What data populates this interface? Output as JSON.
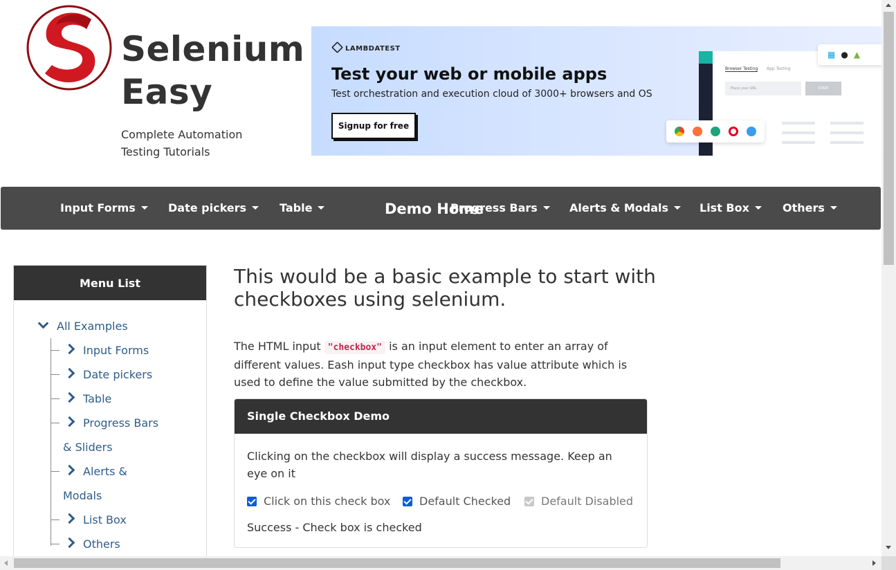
{
  "brand": {
    "title": "Selenium Easy",
    "subtitle": "Complete Automation Testing Tutorials",
    "logo_color": "#c8161d"
  },
  "ad": {
    "logo_text": "LAMBDATEST",
    "headline": "Test your web or mobile apps",
    "text": "Test orchestration and execution cloud of 3000+ browsers and OS",
    "button_label": "Signup for free",
    "mock_tab_1": "Browser Testing",
    "mock_tab_2": "App Testing",
    "mock_url_placeholder": "Place your URL",
    "mock_start": "START"
  },
  "navbar": {
    "home": "Demo Home",
    "items": [
      {
        "label": "Input Forms"
      },
      {
        "label": "Date pickers"
      },
      {
        "label": "Table"
      },
      {
        "label": "Progress Bars"
      },
      {
        "label": "Alerts & Modals"
      },
      {
        "label": "List Box"
      },
      {
        "label": "Others"
      }
    ],
    "bg_color": "#4a4a4a"
  },
  "sidebar": {
    "heading": "Menu List",
    "root": "All Examples",
    "items": [
      {
        "label": "Input Forms"
      },
      {
        "label": "Date pickers"
      },
      {
        "label": "Table"
      },
      {
        "label": "Progress Bars",
        "label_cont": "& Sliders"
      },
      {
        "label": "Alerts &",
        "label_cont": "Modals"
      },
      {
        "label": "List Box"
      },
      {
        "label": "Others"
      }
    ],
    "link_color": "#2e5c8a"
  },
  "main": {
    "title": "This would be a basic example to start with checkboxes using selenium.",
    "intro_before": "The HTML input ",
    "intro_code": "\"checkbox\"",
    "intro_after": " is an input element to enter an array of different values. Eash input type checkbox has value attribute which is used to define the value submitted by the checkbox.",
    "panel": {
      "heading": "Single Checkbox Demo",
      "description": "Clicking on the checkbox will display a success message. Keep an eye on it",
      "checkboxes": [
        {
          "label": "Click on this check box",
          "checked": true,
          "disabled": false
        },
        {
          "label": "Default Checked",
          "checked": true,
          "disabled": false
        },
        {
          "label": "Default Disabled",
          "checked": true,
          "disabled": true
        }
      ],
      "success_message": "Success - Check box is checked"
    }
  }
}
